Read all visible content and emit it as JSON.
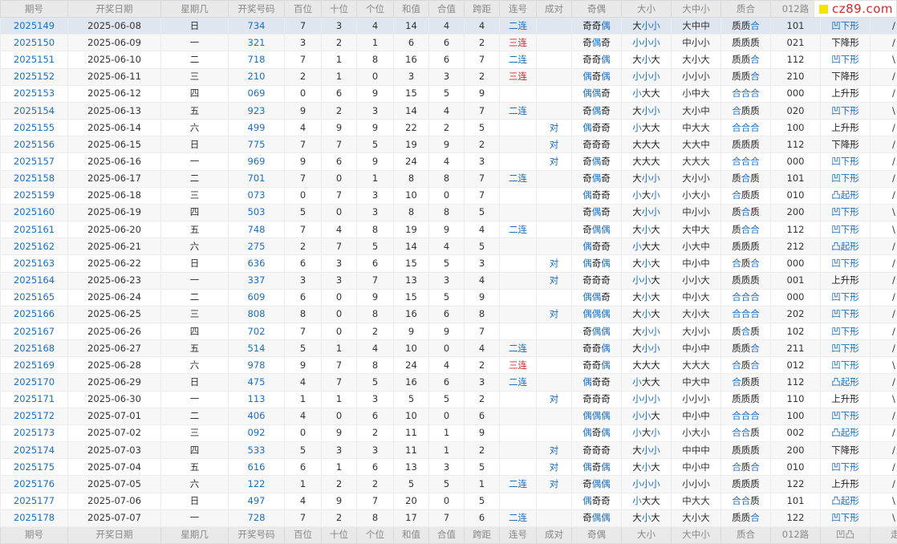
{
  "site": {
    "logo_text": "cz89.com"
  },
  "colors": {
    "blue": "#1a6fc4",
    "red": "#d6262e",
    "header_bg": "#e9e9e9",
    "highlight_row": "#dfe6ef",
    "logo_square": "#f5e300"
  },
  "columns": [
    "期号",
    "开奖日期",
    "星期几",
    "开奖号码",
    "百位",
    "十位",
    "个位",
    "和值",
    "合值",
    "跨距",
    "连号",
    "成对",
    "奇偶",
    "大小",
    "大中小",
    "质合",
    "012路",
    "凹凸",
    "走势"
  ],
  "rows": [
    [
      "2025149",
      "2025-06-08",
      "日",
      "734",
      "7",
      "3",
      "4",
      "14",
      "4",
      "4",
      "二连",
      "",
      "奇奇偶",
      "大小小",
      "大中中",
      "质质合",
      "101",
      "凹下形",
      "/ | /"
    ],
    [
      "2025150",
      "2025-06-09",
      "一",
      "321",
      "3",
      "2",
      "1",
      "6",
      "6",
      "2",
      "三连",
      "",
      "奇偶奇",
      "小小小",
      "中小小",
      "质质质",
      "021",
      "下降形",
      "/ / /"
    ],
    [
      "2025151",
      "2025-06-10",
      "二",
      "718",
      "7",
      "1",
      "8",
      "16",
      "6",
      "7",
      "二连",
      "",
      "奇奇偶",
      "大小大",
      "大小大",
      "质质合",
      "112",
      "凹下形",
      "\\ / \\"
    ],
    [
      "2025152",
      "2025-06-11",
      "三",
      "210",
      "2",
      "1",
      "0",
      "3",
      "3",
      "2",
      "三连",
      "",
      "偶奇偶",
      "小小小",
      "小小小",
      "质质合",
      "210",
      "下降形",
      "/ | /"
    ],
    [
      "2025153",
      "2025-06-12",
      "四",
      "069",
      "0",
      "6",
      "9",
      "15",
      "5",
      "9",
      "",
      "",
      "偶偶奇",
      "小大大",
      "小中大",
      "合合合",
      "000",
      "上升形",
      "/ \\ \\"
    ],
    [
      "2025154",
      "2025-06-13",
      "五",
      "923",
      "9",
      "2",
      "3",
      "14",
      "4",
      "7",
      "二连",
      "",
      "奇偶奇",
      "大小小",
      "大小中",
      "合质质",
      "020",
      "凹下形",
      "\\ / /"
    ],
    [
      "2025155",
      "2025-06-14",
      "六",
      "499",
      "4",
      "9",
      "9",
      "22",
      "2",
      "5",
      "",
      "对",
      "偶奇奇",
      "小大大",
      "中大大",
      "合合合",
      "100",
      "上升形",
      "/ \\ \\"
    ],
    [
      "2025156",
      "2025-06-15",
      "日",
      "775",
      "7",
      "7",
      "5",
      "19",
      "9",
      "2",
      "",
      "对",
      "奇奇奇",
      "大大大",
      "大大中",
      "质质质",
      "112",
      "下降形",
      "/ | \\"
    ],
    [
      "2025157",
      "2025-06-16",
      "一",
      "969",
      "9",
      "6",
      "9",
      "24",
      "4",
      "3",
      "",
      "对",
      "奇偶奇",
      "大大大",
      "大大大",
      "合合合",
      "000",
      "凹下形",
      "/ / \\"
    ],
    [
      "2025158",
      "2025-06-17",
      "二",
      "701",
      "7",
      "0",
      "1",
      "8",
      "8",
      "7",
      "二连",
      "",
      "奇偶奇",
      "大小小",
      "大小小",
      "质合质",
      "101",
      "凹下形",
      "/ / /"
    ],
    [
      "2025159",
      "2025-06-18",
      "三",
      "073",
      "0",
      "7",
      "3",
      "10",
      "0",
      "7",
      "",
      "",
      "偶奇奇",
      "小大小",
      "小大小",
      "合质质",
      "010",
      "凸起形",
      "/ \\ \\"
    ],
    [
      "2025160",
      "2025-06-19",
      "四",
      "503",
      "5",
      "0",
      "3",
      "8",
      "8",
      "5",
      "",
      "",
      "奇偶奇",
      "大小小",
      "中小小",
      "质合质",
      "200",
      "凹下形",
      "\\ / |"
    ],
    [
      "2025161",
      "2025-06-20",
      "五",
      "748",
      "7",
      "4",
      "8",
      "19",
      "9",
      "4",
      "二连",
      "",
      "奇偶偶",
      "大小大",
      "大中大",
      "质合合",
      "112",
      "凹下形",
      "\\ \\ \\"
    ],
    [
      "2025162",
      "2025-06-21",
      "六",
      "275",
      "2",
      "7",
      "5",
      "14",
      "4",
      "5",
      "",
      "",
      "偶奇奇",
      "小大大",
      "小大中",
      "质质质",
      "212",
      "凸起形",
      "/ \\ \\"
    ],
    [
      "2025163",
      "2025-06-22",
      "日",
      "636",
      "6",
      "3",
      "6",
      "15",
      "5",
      "3",
      "",
      "对",
      "偶奇偶",
      "大小大",
      "中小中",
      "合质合",
      "000",
      "凹下形",
      "/ / \\"
    ],
    [
      "2025164",
      "2025-06-23",
      "一",
      "337",
      "3",
      "3",
      "7",
      "13",
      "3",
      "4",
      "",
      "对",
      "奇奇奇",
      "小小大",
      "小小大",
      "质质质",
      "001",
      "上升形",
      "/ / \\"
    ],
    [
      "2025165",
      "2025-06-24",
      "二",
      "609",
      "6",
      "0",
      "9",
      "15",
      "5",
      "9",
      "",
      "",
      "偶偶奇",
      "大小大",
      "中小大",
      "合合合",
      "000",
      "凹下形",
      "/ / \\"
    ],
    [
      "2025166",
      "2025-06-25",
      "三",
      "808",
      "8",
      "0",
      "8",
      "16",
      "6",
      "8",
      "",
      "对",
      "偶偶偶",
      "大小大",
      "大小大",
      "合合合",
      "202",
      "凹下形",
      "/ | /"
    ],
    [
      "2025167",
      "2025-06-26",
      "四",
      "702",
      "7",
      "0",
      "2",
      "9",
      "9",
      "7",
      "",
      "",
      "奇偶偶",
      "大小小",
      "大小小",
      "质合质",
      "102",
      "凹下形",
      "/ / /"
    ],
    [
      "2025168",
      "2025-06-27",
      "五",
      "514",
      "5",
      "1",
      "4",
      "10",
      "0",
      "4",
      "二连",
      "",
      "奇奇偶",
      "大小小",
      "中小中",
      "质质合",
      "211",
      "凹下形",
      "/ / /"
    ],
    [
      "2025169",
      "2025-06-28",
      "六",
      "978",
      "9",
      "7",
      "8",
      "24",
      "4",
      "2",
      "三连",
      "",
      "奇奇偶",
      "大大大",
      "大大大",
      "合质合",
      "012",
      "凹下形",
      "\\ \\ \\"
    ],
    [
      "2025170",
      "2025-06-29",
      "日",
      "475",
      "4",
      "7",
      "5",
      "16",
      "6",
      "3",
      "二连",
      "",
      "偶奇奇",
      "小大大",
      "中大中",
      "合质质",
      "112",
      "凸起形",
      "/ / \\"
    ],
    [
      "2025171",
      "2025-06-30",
      "一",
      "113",
      "1",
      "1",
      "3",
      "5",
      "5",
      "2",
      "",
      "对",
      "奇奇奇",
      "小小小",
      "小小小",
      "质质质",
      "110",
      "上升形",
      "\\ | /"
    ],
    [
      "2025172",
      "2025-07-01",
      "二",
      "406",
      "4",
      "0",
      "6",
      "10",
      "0",
      "6",
      "",
      "",
      "偶偶偶",
      "小小大",
      "中小中",
      "合合合",
      "100",
      "凹下形",
      "/ / \\"
    ],
    [
      "2025173",
      "2025-07-02",
      "三",
      "092",
      "0",
      "9",
      "2",
      "11",
      "1",
      "9",
      "",
      "",
      "偶奇偶",
      "小大小",
      "小大小",
      "合合质",
      "002",
      "凸起形",
      "/ \\ \\"
    ],
    [
      "2025174",
      "2025-07-03",
      "四",
      "533",
      "5",
      "3",
      "3",
      "11",
      "1",
      "2",
      "",
      "对",
      "奇奇奇",
      "大小小",
      "中中中",
      "质质质",
      "200",
      "下降形",
      "/ / \\"
    ],
    [
      "2025175",
      "2025-07-04",
      "五",
      "616",
      "6",
      "1",
      "6",
      "13",
      "3",
      "5",
      "",
      "对",
      "偶奇偶",
      "大小大",
      "中小中",
      "合质合",
      "010",
      "凹下形",
      "/ / \\"
    ],
    [
      "2025176",
      "2025-07-05",
      "六",
      "122",
      "1",
      "2",
      "2",
      "5",
      "5",
      "1",
      "二连",
      "对",
      "奇偶偶",
      "小小小",
      "小小小",
      "质质质",
      "122",
      "上升形",
      "/ / \\"
    ],
    [
      "2025177",
      "2025-07-06",
      "日",
      "497",
      "4",
      "9",
      "7",
      "20",
      "0",
      "5",
      "",
      "",
      "偶奇奇",
      "小大大",
      "中大大",
      "合合质",
      "101",
      "凸起形",
      "\\ \\ \\"
    ],
    [
      "2025178",
      "2025-07-07",
      "一",
      "728",
      "7",
      "2",
      "8",
      "17",
      "7",
      "6",
      "二连",
      "",
      "奇偶偶",
      "大小大",
      "大小大",
      "质质合",
      "122",
      "凹下形",
      "\\ \\ \\"
    ]
  ]
}
